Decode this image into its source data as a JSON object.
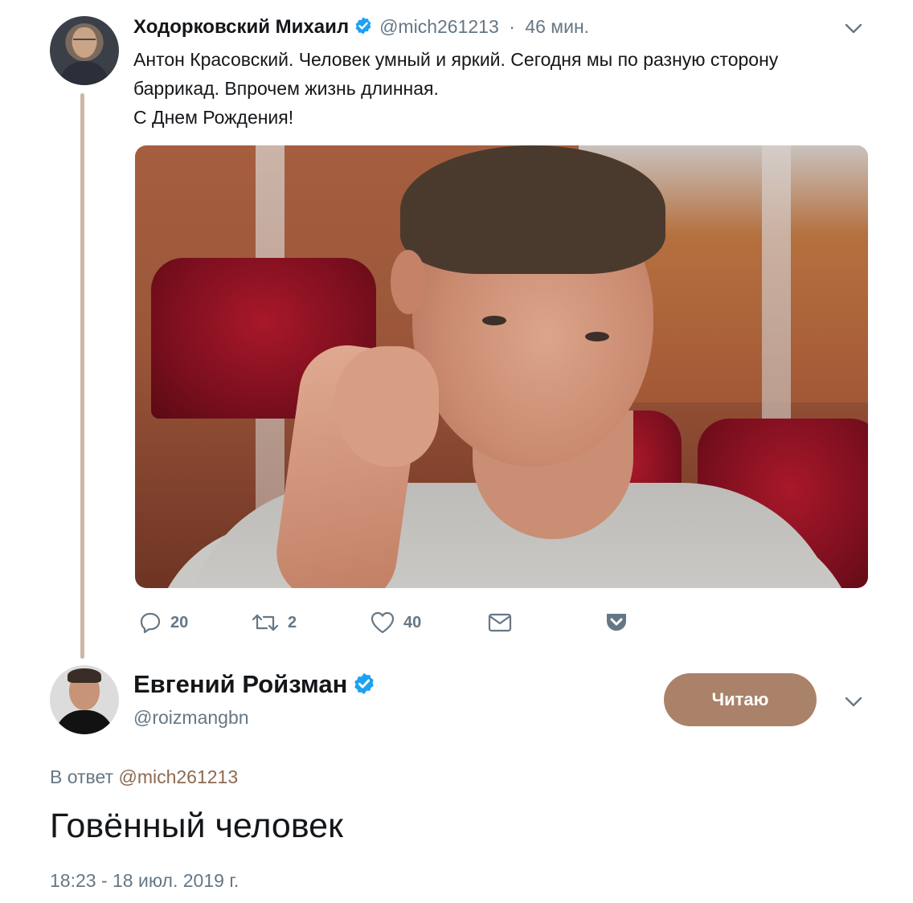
{
  "colors": {
    "text_primary": "#14171a",
    "text_secondary": "#657786",
    "accent_brown": "#aa8269",
    "verified_blue": "#1da1f2",
    "thread_line": "#cdb6a4"
  },
  "tweet1": {
    "author_name": "Ходорковский Михаил",
    "handle": "@mich261213",
    "separator": "·",
    "time": "46 мин.",
    "verified_icon": "verified-badge-icon",
    "text_lines": [
      "Антон Красовский. Человек умный и яркий. Сегодня мы по разную сторону",
      "баррикад. Впрочем жизнь длинная.",
      "С Днем Рождения!"
    ],
    "actions": {
      "reply_count": "20",
      "retweet_count": "2",
      "like_count": "40"
    }
  },
  "tweet2": {
    "author_name": "Евгений Ройзман",
    "handle": "@roizmangbn",
    "follow_label": "Читаю",
    "reply_prefix": "В ответ",
    "reply_mention": "@mich261213",
    "text": "Говённый человек",
    "timestamp": "18:23 - 18 июл. 2019 г."
  }
}
